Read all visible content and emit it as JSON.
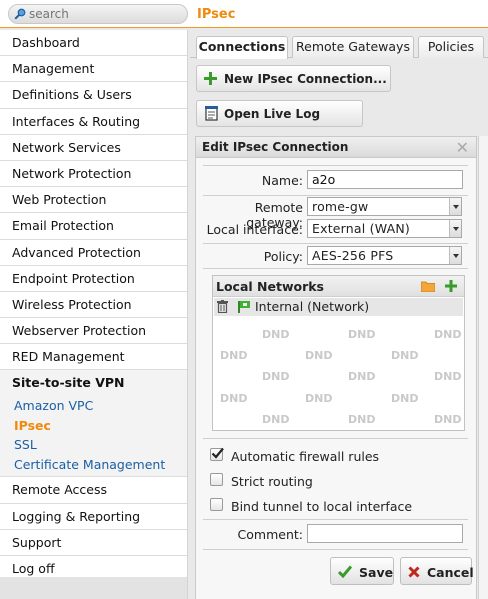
{
  "search": {
    "placeholder": "search"
  },
  "page_title": "IPsec",
  "sidebar": {
    "items_top": [
      "Dashboard",
      "Management",
      "Definitions & Users",
      "Interfaces & Routing",
      "Network Services",
      "Network Protection",
      "Web Protection",
      "Email Protection",
      "Advanced Protection",
      "Endpoint Protection",
      "Wireless Protection",
      "Webserver Protection",
      "RED Management"
    ],
    "section": "Site-to-site VPN",
    "sub_items": [
      "Amazon VPC",
      "IPsec",
      "SSL",
      "Certificate Management"
    ],
    "active_sub": "IPsec",
    "items_bottom": [
      "Remote Access",
      "Logging & Reporting",
      "Support",
      "Log off"
    ]
  },
  "tabs": [
    "Connections",
    "Remote Gateways",
    "Policies"
  ],
  "actions": {
    "new_connection": "New IPsec Connection...",
    "open_log": "Open Live Log"
  },
  "dialog": {
    "title": "Edit IPsec Connection",
    "name_label": "Name:",
    "name_value": "a2o",
    "remote_gateway_label": "Remote gateway:",
    "remote_gateway_value": "rome-gw",
    "local_interface_label": "Local interface:",
    "local_interface_value": "External (WAN)",
    "policy_label": "Policy:",
    "policy_value": "AES-256 PFS",
    "local_networks_title": "Local Networks",
    "local_network_item": "Internal (Network)",
    "dnd_text": "DND",
    "auto_firewall_label": "Automatic firewall rules",
    "strict_routing_label": "Strict routing",
    "bind_tunnel_label": "Bind tunnel to local interface",
    "comment_label": "Comment:",
    "comment_value": "",
    "save_label": "Save",
    "cancel_label": "Cancel",
    "auto_firewall_checked": true,
    "strict_routing_checked": false,
    "bind_tunnel_checked": false
  },
  "colors": {
    "accent": "#f08a0c",
    "link": "#1a5fa3",
    "add_green": "#3a9a2a",
    "cancel_red": "#c0281e"
  }
}
